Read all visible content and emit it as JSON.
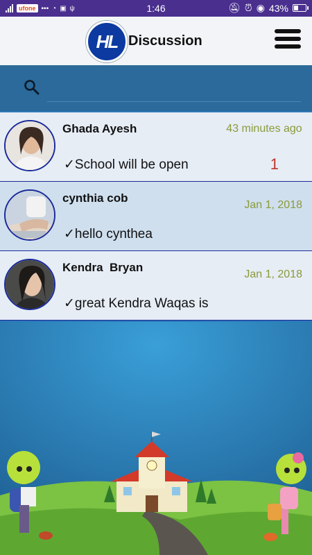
{
  "status": {
    "carrier": "ufone",
    "time": "1:46",
    "battery": "43%",
    "battery_level": 0.43
  },
  "header": {
    "logo_text": "HL",
    "title": "Discussion"
  },
  "search": {
    "placeholder": ""
  },
  "conversations": [
    {
      "name": "Ghada Ayesh",
      "message": "School will be open",
      "time": "43 minutes ago",
      "unread": "1"
    },
    {
      "name": "cynthia cob",
      "message": "hello cynthea",
      "time": "Jan 1, 2018"
    },
    {
      "name": "Kendra  Bryan",
      "message": "great Kendra Waqas is",
      "time": "Jan 1, 2018"
    }
  ],
  "colors": {
    "status_bar": "#4a2f8f",
    "header_bg": "#f2f4f7",
    "search_bg": "#2b6a9a",
    "time_text": "#8a9a3a",
    "unread_text": "#c0352b",
    "logo_bg": "#0c3aa0"
  }
}
